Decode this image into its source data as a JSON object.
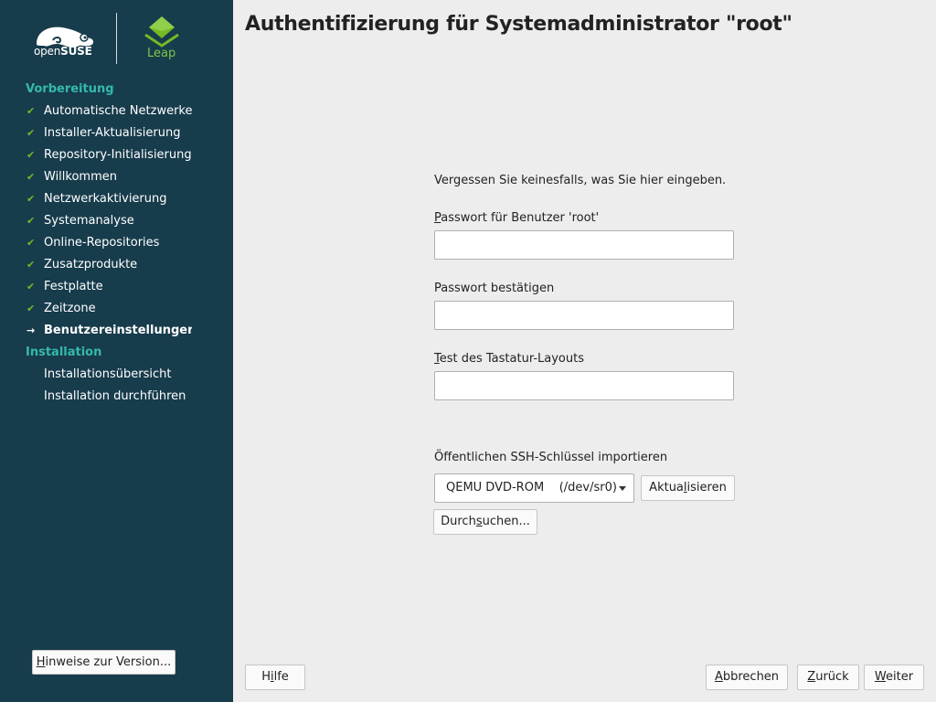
{
  "sidebar": {
    "logo_brand_light": "open",
    "logo_brand_bold": "SUSE",
    "leap_label": "Leap",
    "section_preparation": "Vorbereitung",
    "preparation_steps": [
      {
        "label": "Automatische Netzwerkeinrichtung",
        "status": "done"
      },
      {
        "label": "Installer-Aktualisierung",
        "status": "done"
      },
      {
        "label": "Repository-Initialisierung",
        "status": "done"
      },
      {
        "label": "Willkommen",
        "status": "done"
      },
      {
        "label": "Netzwerkaktivierung",
        "status": "done"
      },
      {
        "label": "Systemanalyse",
        "status": "done"
      },
      {
        "label": "Online-Repositories",
        "status": "done"
      },
      {
        "label": "Zusatzprodukte",
        "status": "done"
      },
      {
        "label": "Festplatte",
        "status": "done"
      },
      {
        "label": "Zeitzone",
        "status": "done"
      },
      {
        "label": "Benutzereinstellungen",
        "status": "current"
      }
    ],
    "section_installation": "Installation",
    "installation_steps": [
      {
        "label": "Installationsübersicht",
        "status": "pending"
      },
      {
        "label": "Installation durchführen",
        "status": "pending"
      }
    ],
    "release_notes_prefix": "",
    "release_notes_mnemonic": "H",
    "release_notes_rest": "inweise zur Version..."
  },
  "main": {
    "title": "Authentifizierung für Systemadministrator \"root\"",
    "intro": "Vergessen Sie keinesfalls, was Sie hier eingeben.",
    "password_label_mnemonic": "P",
    "password_label_rest": "asswort für Benutzer 'root'",
    "password_value": "",
    "confirm_label": "Passwort bestätigen",
    "confirm_value": "",
    "keyboard_test_label_mnemonic": "T",
    "keyboard_test_label_rest": "est des Tastatur-Layouts",
    "keyboard_test_value": "",
    "ssh_label": "Öffentlichen SSH-Schlüssel importieren",
    "ssh_selected": "QEMU DVD-ROM    (/dev/sr0)",
    "refresh_prefix": "Aktua",
    "refresh_mnemonic": "l",
    "refresh_rest": "isieren",
    "browse_prefix": "Durch",
    "browse_mnemonic": "s",
    "browse_rest": "uchen..."
  },
  "footer": {
    "help_prefix": "H",
    "help_mnemonic": "i",
    "help_rest": "lfe",
    "abort_mnemonic": "A",
    "abort_rest": "bbrechen",
    "back_mnemonic": "Z",
    "back_rest": "urück",
    "next_mnemonic": "W",
    "next_rest": "eiter"
  },
  "colors": {
    "sidebar_bg": "#173c4c",
    "section_title": "#35b9ab",
    "check_mark": "#73ba25",
    "leap_green": "#7ec845",
    "main_bg": "#ededed"
  },
  "icons": {
    "done": "check-icon",
    "current": "arrow-right-icon"
  }
}
